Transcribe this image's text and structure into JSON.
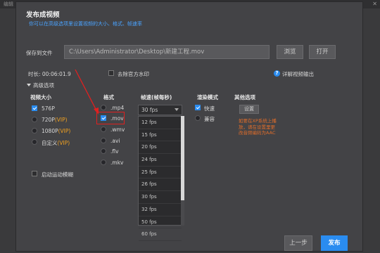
{
  "background": {
    "title": "编辑"
  },
  "dialog": {
    "title": "发布成视频",
    "subtitle": "你可以在高级选项里设置视频的大小、格式、帧速率",
    "save_to_label": "保存到文件",
    "save_path": "C:\\Users\\Administrator\\Desktop\\新建工程.mov",
    "browse_label": "浏览",
    "open_label": "打开",
    "duration": "时长: 00:06:01.9",
    "remove_watermark": "去除官方水印",
    "details_link": "详解视频输出",
    "advanced_label": "高级选项",
    "video_size": {
      "header": "视频大小",
      "options": [
        {
          "label": "576P",
          "vip": "",
          "selected": true
        },
        {
          "label": "720P",
          "vip": "(VIP)",
          "selected": false
        },
        {
          "label": "1080P",
          "vip": "(VIP)",
          "selected": false
        },
        {
          "label": "自定义",
          "vip": "(VIP)",
          "selected": false
        }
      ]
    },
    "format": {
      "header": "格式",
      "options": [
        {
          "label": ".mp4",
          "selected": false
        },
        {
          "label": ".mov",
          "selected": true
        },
        {
          "label": ".wmv",
          "selected": false
        },
        {
          "label": ".avi",
          "selected": false
        },
        {
          "label": ".flv",
          "selected": false
        },
        {
          "label": ".mkv",
          "selected": false
        }
      ]
    },
    "fps": {
      "header": "帧速(帧每秒)",
      "selected": "30 fps",
      "options": [
        "12 fps",
        "15 fps",
        "20 fps",
        "24 fps",
        "25 fps",
        "26 fps",
        "30 fps",
        "32 fps",
        "50 fps",
        "60 fps"
      ]
    },
    "render_mode": {
      "header": "渲染模式",
      "options": [
        {
          "label": "快速",
          "selected": true
        },
        {
          "label": "兼容",
          "selected": false
        }
      ]
    },
    "other": {
      "header": "其他选项",
      "settings_label": "设置",
      "warning": "如要在XP系统上播放，请在设置里更改音频编码为AAC"
    },
    "motion_blur": "启动运动模糊",
    "prev_label": "上一步",
    "publish_label": "发布"
  },
  "colors": {
    "accent": "#2a8cf0",
    "warning": "#e06d2a",
    "vip": "#f0a020",
    "annotation": "#e02020"
  }
}
